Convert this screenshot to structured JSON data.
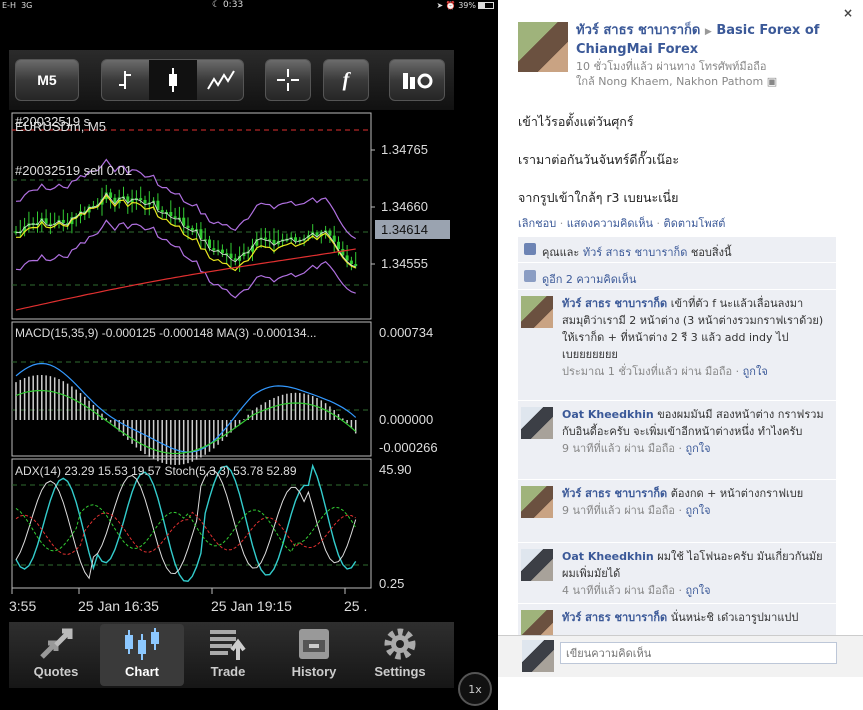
{
  "status": {
    "carrier": "E-H",
    "network": "3G",
    "time": "0:33",
    "battery": "39%"
  },
  "toolbar": {
    "timeframe": "M5",
    "crosshair_icon": "crosshair-icon",
    "function_label": "f"
  },
  "chart": {
    "main_label": "#20032519 s",
    "symbol_label": "EURUSDm, M5",
    "order_label": "#20032519 sell 0.01",
    "main_prices": [
      "1.34765",
      "1.34660",
      "1.34555"
    ],
    "current_price": "1.34614",
    "macd_label": "MACD(15,35,9) -0.000125 -0.000148 MA(3) -0.000134...",
    "macd_prices": [
      "0.000734",
      "0.000000",
      "-0.000266"
    ],
    "adx_label": "ADX(14) 23.29 15.53 19.57 Stoch(5,3,3) 53.78 52.89",
    "adx_prices": [
      "45.90",
      "0.25"
    ],
    "time_labels": [
      "3:55",
      "25 Jan 16:35",
      "25 Jan 19:15",
      "25 ."
    ],
    "colors": {
      "bull": "#33cc33",
      "red": "#e03030",
      "yellow": "#e8e820",
      "purple": "#b070e0",
      "blue": "#3399ff",
      "cyan": "#33cccc"
    }
  },
  "tabs": [
    {
      "label": "Quotes",
      "icon": "quotes-arrows-icon"
    },
    {
      "label": "Chart",
      "icon": "chart-candles-icon"
    },
    {
      "label": "Trade",
      "icon": "trade-list-icon"
    },
    {
      "label": "History",
      "icon": "history-cabinet-icon"
    },
    {
      "label": "Settings",
      "icon": "settings-gear-icon"
    }
  ],
  "zoom": "1x",
  "post": {
    "close": "×",
    "author": "ทัวร์ สาธร ชาบาราก็ด",
    "group": "Basic Forex of ChiangMai Forex",
    "meta_line1": "10 ชั่วโมงที่แล้ว ผ่านทาง โทรศัพท์มือถือ",
    "meta_line2": "ใกล้ Nong Khaem, Nakhon Pathom",
    "lines": [
      "เข้าไว้รอตั้งแต่วันศุกร์",
      "เรามาต่อกันวันจันทร์ดีกั๊วเน๊อะ",
      "จากรูปเข้าใกล้ๆ r3 เบยนะเนี่ย"
    ],
    "actions": [
      "เลิกชอบ",
      "แสดงความคิดเห็น",
      "ติดตามโพสต์"
    ],
    "likes_prefix": "คุณและ",
    "likes_name": "ทัวร์ สาธร ชาบาราก็ด",
    "likes_suffix": "ชอบสิ่งนี้",
    "view_comments": "ดูอีก 2 ความคิดเห็น",
    "reply_placeholder": "เขียนความคิดเห็น"
  },
  "comments": [
    {
      "author": "ทัวร์ สาธร ชาบาราก็ด",
      "text": "เข้าที่ตัว f นะแล้วเลื่อนลงมา สมมุติว่าเรามี 2 หน้าต่าง (3 หน้าต่างรวมกราฟเราด้วย) ให้เราก็ด + ที่หน้าต่าง 2 รี 3 แล้ว add indy ไป เบยยยยยยย",
      "time": "ประมาณ 1 ชั่วโมงที่แล้ว ผ่าน มือถือ",
      "like": "ถูกใจ"
    },
    {
      "author": "Oat Kheedkhin",
      "text": "ของผมมันมี สองหน้าต่าง กราฟรวมกับอินดี้อะครับ จะเพิ่มเข้าอีกหน้าต่างหนึ่ง ทำไงครับ",
      "time": "9 นาทีที่แล้ว ผ่าน มือถือ",
      "like": "ถูกใจ"
    },
    {
      "author": "ทัวร์ สาธร ชาบาราก็ด",
      "text": "ต้องกด + หน้าต่างกราฟเบย",
      "time": "9 นาทีที่แล้ว ผ่าน มือถือ",
      "like": "ถูกใจ"
    },
    {
      "author": "Oat Kheedkhin",
      "text": "ผมใช้ ไอโฟนอะครับ มันเกี่ยวกันมัย ผมเพิ่มมัยได้",
      "time": "4 นาทีที่แล้ว ผ่าน มือถือ",
      "like": "ถูกใจ"
    },
    {
      "author": "ทัวร์ สาธร ชาบาราก็ด",
      "text": "นั่นหน่ะชิ เด๋วเอารูปมาแปป",
      "time": "",
      "like": ""
    }
  ]
}
